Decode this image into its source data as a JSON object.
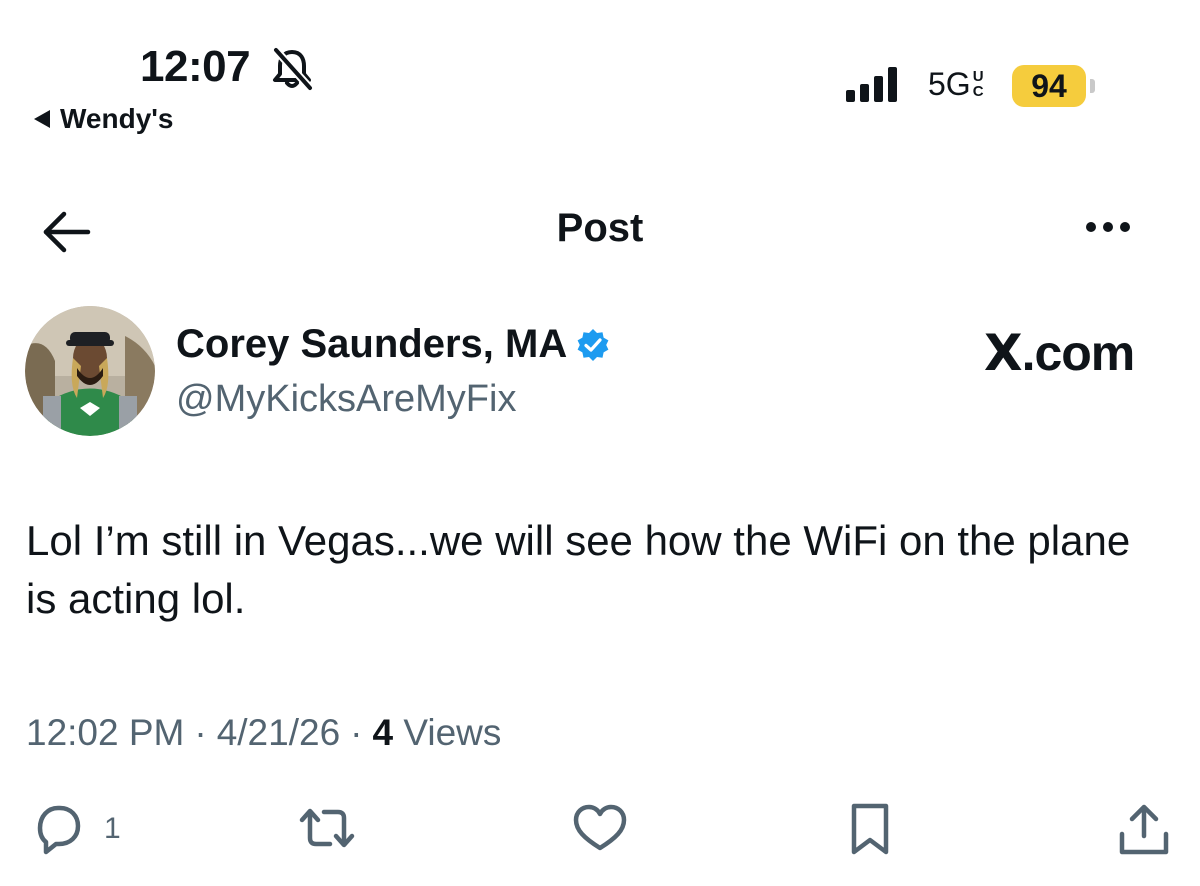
{
  "status_bar": {
    "time": "12:07",
    "back_app": "Wendy's",
    "network": "5G",
    "network_sup_top": "U",
    "network_sup_bottom": "C",
    "battery": "94"
  },
  "nav": {
    "title": "Post"
  },
  "author": {
    "name": "Corey Saunders, MA",
    "handle": "@MyKicksAreMyFix",
    "verified": true
  },
  "watermark": {
    "text": ".com",
    "logo_letter": "X"
  },
  "post": {
    "text": "Lol I’m still in Vegas...we will see how the WiFi on the plane is acting lol.",
    "time": "12:02 PM",
    "date": "4/21/26",
    "views_count": "4",
    "views_label": "Views",
    "separator": "·"
  },
  "actions": {
    "reply_count": "1"
  },
  "colors": {
    "text": "#0f1419",
    "secondary": "#536471",
    "verified": "#1d9bf0",
    "battery": "#f5cc3d"
  },
  "icons": [
    "bell-slash-icon",
    "back-arrow-icon",
    "more-icon",
    "verified-badge-icon",
    "reply-icon",
    "repost-icon",
    "like-icon",
    "bookmark-icon",
    "share-icon"
  ]
}
